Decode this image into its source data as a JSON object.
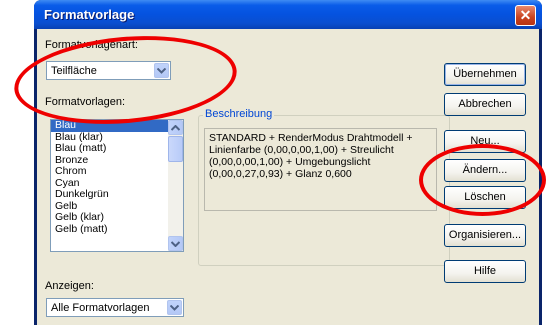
{
  "window": {
    "title": "Formatvorlage",
    "close_label": "✕"
  },
  "formatvorlagenart": {
    "label": "Formatvorlagenart:",
    "value": "Teilfläche"
  },
  "formatvorlagen": {
    "label": "Formatvorlagen:",
    "items": [
      "Blau",
      "Blau (klar)",
      "Blau (matt)",
      "Bronze",
      "Chrom",
      "Cyan",
      "Dunkelgrün",
      "Gelb",
      "Gelb (klar)",
      "Gelb (matt)"
    ],
    "selected_index": 0
  },
  "beschreibung": {
    "title": "Beschreibung",
    "text": "STANDARD + RenderModus Drahtmodell + Linienfarbe (0,00,0,00,1,00) + Streulicht (0,00,0,00,1,00) + Umgebungslicht (0,00,0,27,0,93) + Glanz 0,600"
  },
  "anzeigen": {
    "label": "Anzeigen:",
    "value": "Alle Formatvorlagen"
  },
  "buttons": {
    "uebernehmen": "Übernehmen",
    "abbrechen": "Abbrechen",
    "neu": "Neu...",
    "aendern": "Ändern...",
    "loeschen": "Löschen",
    "organisieren": "Organisieren...",
    "hilfe": "Hilfe"
  },
  "annotation_color": "#ee0000"
}
